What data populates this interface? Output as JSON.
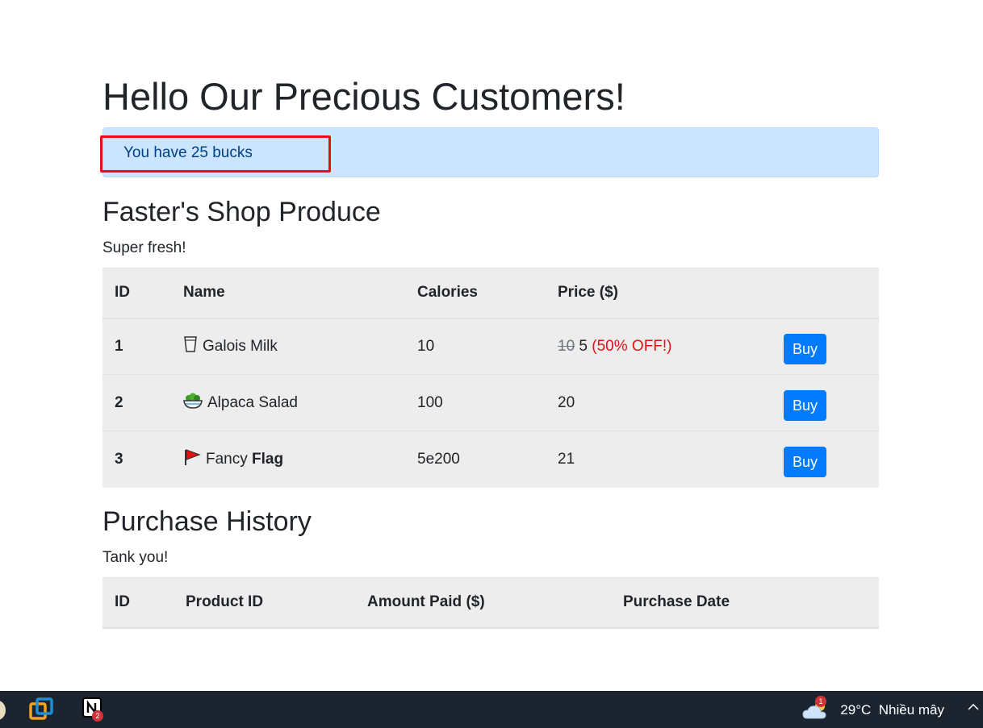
{
  "page": {
    "title": "Hello Our Precious Customers!",
    "balance_text": "You have 25 bucks"
  },
  "produce": {
    "heading": "Faster's Shop Produce",
    "subtitle": "Super fresh!",
    "columns": [
      "ID",
      "Name",
      "Calories",
      "Price ($)"
    ],
    "rows": [
      {
        "id": "1",
        "icon": "milk-glass-icon",
        "name": "Galois Milk",
        "name_bold": "",
        "calories": "10",
        "price_old": "10",
        "price": "5",
        "discount": "(50% OFF!)",
        "buy_label": "Buy"
      },
      {
        "id": "2",
        "icon": "salad-bowl-icon",
        "name": "Alpaca Salad",
        "name_bold": "",
        "calories": "100",
        "price_old": "",
        "price": "20",
        "discount": "",
        "buy_label": "Buy"
      },
      {
        "id": "3",
        "icon": "red-flag-icon",
        "name": "Fancy",
        "name_bold": "Flag",
        "calories": "5e200",
        "price_old": "",
        "price": "21",
        "discount": "",
        "buy_label": "Buy"
      }
    ]
  },
  "history": {
    "heading": "Purchase History",
    "subtitle": "Tank you!",
    "columns": [
      "ID",
      "Product ID",
      "Amount Paid ($)",
      "Purchase Date"
    ],
    "rows": []
  },
  "taskbar": {
    "apps": [
      "vmware-icon",
      "notion-icon"
    ],
    "notion_badge": "2",
    "weather_badge": "1",
    "weather_icon": "cloudy-icon",
    "temperature": "29°C",
    "weather_text": "Nhiều mây"
  },
  "colors": {
    "alert_bg": "#cce5ff",
    "alert_text": "#004085",
    "button": "#007bff",
    "discount": "#e31212",
    "highlight": "#e31212"
  }
}
